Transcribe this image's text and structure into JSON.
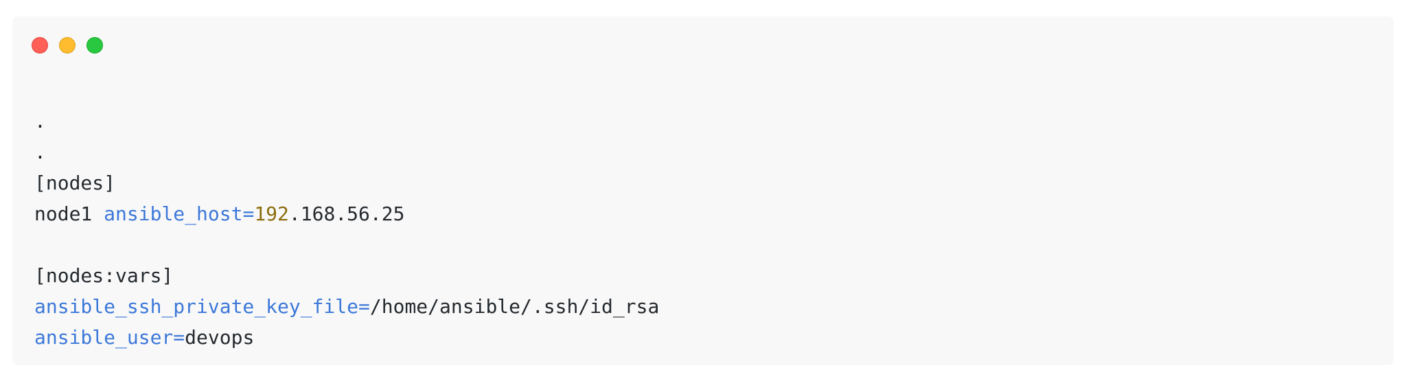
{
  "window": {
    "controls": [
      "close-button",
      "minimize-button",
      "maximize-button"
    ]
  },
  "code": {
    "line1": ".",
    "line2": ".",
    "line3": "[nodes]",
    "line4": {
      "host": "node1 ",
      "key": "ansible_host=",
      "ip_prefix": "192",
      "ip_rest": ".168.56.25"
    },
    "line5": "",
    "line6": "[nodes:vars]",
    "line7": {
      "key": "ansible_ssh_private_key_file=",
      "value": "/home/ansible/.ssh/id_rsa"
    },
    "line8": {
      "key": "ansible_user=",
      "value": "devops"
    }
  },
  "colors": {
    "key": "#3c78d8",
    "number": "#8a6d0b",
    "text": "#24292e",
    "background": "#f8f8f8"
  }
}
